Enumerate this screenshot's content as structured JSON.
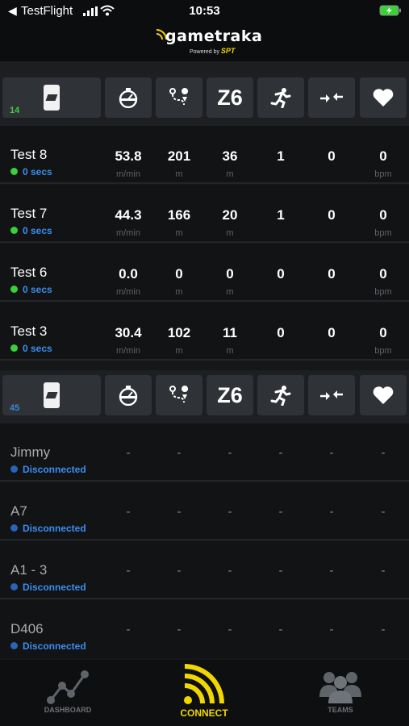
{
  "status_bar": {
    "back_app": "TestFlight",
    "time": "10:53"
  },
  "header": {
    "logo_text": "gametraka",
    "powered_by": "Powered by",
    "powered_brand": "SPT"
  },
  "groups": [
    {
      "count": "14",
      "count_color": "#3fce3f",
      "header_icons": [
        "device-icon",
        "stopwatch-icon",
        "route-icon",
        "z6-label",
        "sprint-icon",
        "impact-icon",
        "heart-icon"
      ],
      "z6_label": "Z6",
      "players": [
        {
          "name": "Test 8",
          "status": "0 secs",
          "stats": [
            "53.8",
            "201",
            "36",
            "1",
            "0",
            "0"
          ]
        },
        {
          "name": "Test 7",
          "status": "0 secs",
          "stats": [
            "44.3",
            "166",
            "20",
            "1",
            "0",
            "0"
          ]
        },
        {
          "name": "Test 6",
          "status": "0 secs",
          "stats": [
            "0.0",
            "0",
            "0",
            "0",
            "0",
            "0"
          ]
        },
        {
          "name": "Test 3",
          "status": "0 secs",
          "stats": [
            "30.4",
            "102",
            "11",
            "0",
            "0",
            "0"
          ]
        }
      ]
    },
    {
      "count": "45",
      "count_color": "#3f86de",
      "z6_label": "Z6",
      "players": [
        {
          "name": "Jimmy",
          "status": "Disconnected",
          "stats": [
            "-",
            "-",
            "-",
            "-",
            "-",
            "-"
          ]
        },
        {
          "name": "A7",
          "status": "Disconnected",
          "stats": [
            "-",
            "-",
            "-",
            "-",
            "-",
            "-"
          ]
        },
        {
          "name": "A1 - 3",
          "status": "Disconnected",
          "stats": [
            "-",
            "-",
            "-",
            "-",
            "-",
            "-"
          ]
        },
        {
          "name": "D406",
          "status": "Disconnected",
          "stats": [
            "-",
            "-",
            "-",
            "-",
            "-",
            "-"
          ]
        }
      ]
    }
  ],
  "units": [
    "m/min",
    "m",
    "m",
    "bpm"
  ],
  "tabs": [
    {
      "label": "DASHBOARD",
      "icon": "dashboard-icon",
      "active": false
    },
    {
      "label": "CONNECT",
      "icon": "connect-icon",
      "active": true
    },
    {
      "label": "TEAMS",
      "icon": "teams-icon",
      "active": false
    }
  ],
  "colors": {
    "accent": "#f1d600",
    "connected": "#39d039",
    "disconnected": "#2a63b8",
    "link": "#3a8ef0"
  }
}
